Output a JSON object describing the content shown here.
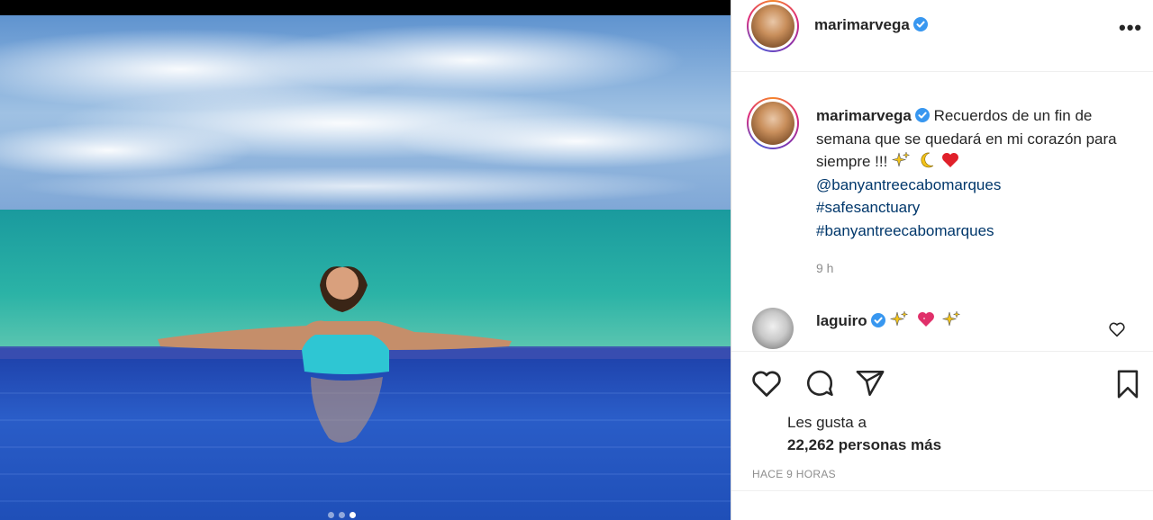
{
  "post": {
    "username": "marimarvega",
    "caption_text": "Recuerdos de un fin de semana que se quedará en mi corazón para siempre !!!",
    "mention": "@banyantreecabomarques",
    "hashtags": [
      "#safesanctuary",
      "#banyantreecabomarques"
    ],
    "time_short": "9 h",
    "carousel": {
      "count": 3,
      "active_index": 2
    }
  },
  "comment": {
    "username": "laguiro"
  },
  "likes": {
    "line1": "Les gusta a",
    "line2": "22,262 personas más"
  },
  "time_ago": "HACE 9 HORAS",
  "icons": [
    "more-options-icon",
    "verified-icon",
    "heart-icon",
    "comment-icon",
    "share-icon",
    "bookmark-icon",
    "sparkles-icon",
    "crescent-moon-icon",
    "red-heart-icon"
  ],
  "colors": {
    "verified": "#3897f0",
    "link": "#00376b",
    "muted": "#8e8e8e"
  }
}
